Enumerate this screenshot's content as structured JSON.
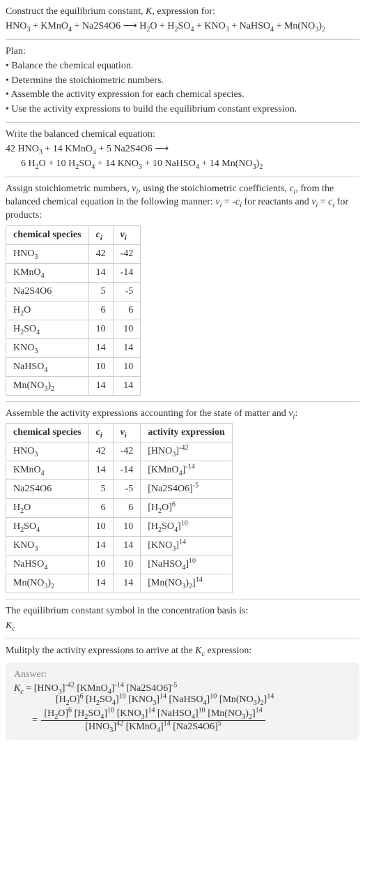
{
  "intro": {
    "line1": "Construct the equilibrium constant, K, expression for:",
    "reaction": "HNO_3 + KMnO_4 + Na2S4O6 ⟶ H_2O + H_2SO_4 + KNO_3 + NaHSO_4 + Mn(NO_3)_2"
  },
  "plan": {
    "heading": "Plan:",
    "items": [
      "• Balance the chemical equation.",
      "• Determine the stoichiometric numbers.",
      "• Assemble the activity expression for each chemical species.",
      "• Use the activity expressions to build the equilibrium constant expression."
    ]
  },
  "balanced": {
    "heading": "Write the balanced chemical equation:",
    "line1": "42 HNO_3 + 14 KMnO_4 + 5 Na2S4O6 ⟶",
    "line2": "6 H_2O + 10 H_2SO_4 + 14 KNO_3 + 10 NaHSO_4 + 14 Mn(NO_3)_2"
  },
  "assign": {
    "text": "Assign stoichiometric numbers, ν_i, using the stoichiometric coefficients, c_i, from the balanced chemical equation in the following manner: ν_i = -c_i for reactants and ν_i = c_i for products:"
  },
  "table1": {
    "headers": [
      "chemical species",
      "c_i",
      "ν_i"
    ],
    "rows": [
      {
        "sp": "HNO_3",
        "c": "42",
        "v": "-42"
      },
      {
        "sp": "KMnO_4",
        "c": "14",
        "v": "-14"
      },
      {
        "sp": "Na2S4O6",
        "c": "5",
        "v": "-5"
      },
      {
        "sp": "H_2O",
        "c": "6",
        "v": "6"
      },
      {
        "sp": "H_2SO_4",
        "c": "10",
        "v": "10"
      },
      {
        "sp": "KNO_3",
        "c": "14",
        "v": "14"
      },
      {
        "sp": "NaHSO_4",
        "c": "10",
        "v": "10"
      },
      {
        "sp": "Mn(NO_3)_2",
        "c": "14",
        "v": "14"
      }
    ]
  },
  "assemble": {
    "text": "Assemble the activity expressions accounting for the state of matter and ν_i:"
  },
  "table2": {
    "headers": [
      "chemical species",
      "c_i",
      "ν_i",
      "activity expression"
    ],
    "rows": [
      {
        "sp": "HNO_3",
        "c": "42",
        "v": "-42",
        "a": "[HNO_3]^(-42)"
      },
      {
        "sp": "KMnO_4",
        "c": "14",
        "v": "-14",
        "a": "[KMnO_4]^(-14)"
      },
      {
        "sp": "Na2S4O6",
        "c": "5",
        "v": "-5",
        "a": "[Na2S4O6]^(-5)"
      },
      {
        "sp": "H_2O",
        "c": "6",
        "v": "6",
        "a": "[H_2O]^6"
      },
      {
        "sp": "H_2SO_4",
        "c": "10",
        "v": "10",
        "a": "[H_2SO_4]^10"
      },
      {
        "sp": "KNO_3",
        "c": "14",
        "v": "14",
        "a": "[KNO_3]^14"
      },
      {
        "sp": "NaHSO_4",
        "c": "10",
        "v": "10",
        "a": "[NaHSO_4]^10"
      },
      {
        "sp": "Mn(NO_3)_2",
        "c": "14",
        "v": "14",
        "a": "[Mn(NO_3)_2]^14"
      }
    ]
  },
  "symbol": {
    "text": "The equilibrium constant symbol in the concentration basis is:",
    "sym": "K_c"
  },
  "multiply": {
    "text": "Mulitply the activity expressions to arrive at the K_c expression:"
  },
  "answer": {
    "label": "Answer:",
    "line1": "K_c = [HNO_3]^(-42) [KMnO_4]^(-14) [Na2S4O6]^(-5)",
    "line2": "[H_2O]^6 [H_2SO_4]^10 [KNO_3]^14 [NaHSO_4]^10 [Mn(NO_3)_2]^14",
    "frac_num": "[H_2O]^6 [H_2SO_4]^10 [KNO_3]^14 [NaHSO_4]^10 [Mn(NO_3)_2]^14",
    "frac_den": "[HNO_3]^42 [KMnO_4]^14 [Na2S4O6]^5"
  }
}
